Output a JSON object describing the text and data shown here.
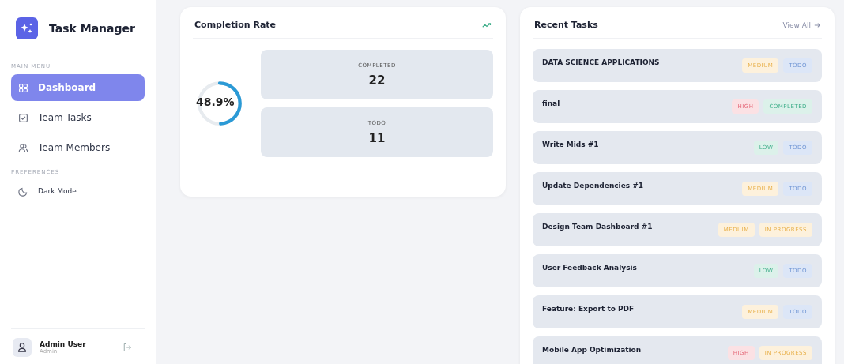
{
  "sidebar": {
    "app_title": "Task Manager",
    "sections": [
      {
        "heading": "MAIN MENU",
        "items": [
          {
            "label": "Dashboard",
            "selected": true
          },
          {
            "label": "Team Tasks",
            "selected": false
          },
          {
            "label": "Team Members",
            "selected": false
          }
        ]
      },
      {
        "heading": "PREFERENCES",
        "items": [
          {
            "label": "Dark Mode",
            "selected": false
          }
        ]
      }
    ],
    "user": {
      "name": "Admin User",
      "role": "Admin"
    }
  },
  "completion": {
    "title": "Completion Rate",
    "percent": "48.9%",
    "level": 0.489,
    "stats": [
      {
        "label": "COMPLETED",
        "value": "22"
      },
      {
        "label": "TODO",
        "value": "11"
      }
    ]
  },
  "recent_tasks": {
    "title": "Recent Tasks",
    "link": "View All",
    "tasks": [
      {
        "title": "DATA SCIENCE APPLICATIONS",
        "tags": [
          {
            "text": "MEDIUM",
            "kind": "medium"
          },
          {
            "text": "TODO",
            "kind": "todo"
          }
        ]
      },
      {
        "title": "final",
        "tags": [
          {
            "text": "HIGH",
            "kind": "high"
          },
          {
            "text": "COMPLETED",
            "kind": "completed"
          }
        ]
      },
      {
        "title": "Write Mids #1",
        "tags": [
          {
            "text": "LOW",
            "kind": "low"
          },
          {
            "text": "TODO",
            "kind": "todo"
          }
        ]
      },
      {
        "title": "Update Dependencies #1",
        "tags": [
          {
            "text": "MEDIUM",
            "kind": "medium"
          },
          {
            "text": "TODO",
            "kind": "todo"
          }
        ]
      },
      {
        "title": "Design Team Dashboard #1",
        "tags": [
          {
            "text": "MEDIUM",
            "kind": "medium"
          },
          {
            "text": "IN PROGRESS",
            "kind": "progress"
          }
        ]
      },
      {
        "title": "User Feedback Analysis",
        "tags": [
          {
            "text": "LOW",
            "kind": "low"
          },
          {
            "text": "TODO",
            "kind": "todo"
          }
        ]
      },
      {
        "title": "Feature: Export to PDF",
        "tags": [
          {
            "text": "MEDIUM",
            "kind": "medium"
          },
          {
            "text": "TODO",
            "kind": "todo"
          }
        ]
      },
      {
        "title": "Mobile App Optimization",
        "tags": [
          {
            "text": "HIGH",
            "kind": "high"
          },
          {
            "text": "IN PROGRESS",
            "kind": "progress"
          }
        ]
      }
    ]
  }
}
